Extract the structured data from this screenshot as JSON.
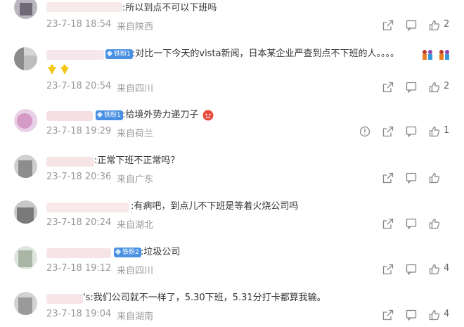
{
  "comments": [
    {
      "text": ":所以到点不可以下班吗",
      "date": "23-7-18 18:54",
      "location": "来自陕西",
      "likes": "2",
      "badge": "",
      "has_report": false
    },
    {
      "text": ":对比一下今天的vista新闻，日本某企业严查到点不下班的人。。。。",
      "date": "23-7-18 20:54",
      "location": "来自四川",
      "likes": "2",
      "badge": "铁粉1",
      "has_report": false
    },
    {
      "text": ":给境外势力递刀子",
      "date": "23-7-18 19:29",
      "location": "来自荷兰",
      "likes": "1",
      "badge": "铁粉1",
      "has_report": true
    },
    {
      "text": ":正常下班不正常吗？",
      "date": "23-7-18 20:36",
      "location": "来自广东",
      "likes": "",
      "badge": "",
      "has_report": false
    },
    {
      "text": ":有病吧，到点儿不下班是等着火烧公司吗",
      "date": "23-7-18 20:24",
      "location": "来自湖北",
      "likes": "",
      "badge": "",
      "has_report": false
    },
    {
      "text": ":垃圾公司",
      "date": "23-7-18 19:12",
      "location": "来自四川",
      "likes": "4",
      "badge": "铁粉2",
      "has_report": false
    },
    {
      "text": "'s:我们公司就不一样了，5.30下班，5.31分打卡都算我输。",
      "date": "23-7-18 19:04",
      "location": "来自湖南",
      "likes": "4",
      "badge": "",
      "has_report": false
    }
  ],
  "icons": {
    "share": "share-icon",
    "comment": "comment-icon",
    "like": "thumb-up-icon",
    "report": "report-icon",
    "emoji_family": "family-emoji",
    "emoji_hand": "pointing-hand-emoji",
    "emoji_angry": "angry-face-emoji"
  },
  "colors": {
    "text": "#333333",
    "meta": "#999999",
    "badge": "#4a90e2"
  }
}
